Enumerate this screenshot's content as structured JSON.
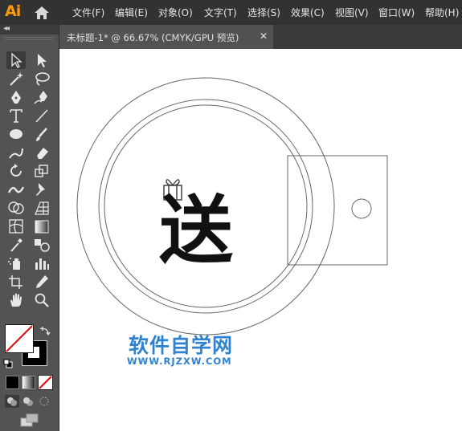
{
  "app": {
    "logo_text": "Ai"
  },
  "menu": {
    "items": [
      "文件(F)",
      "编辑(E)",
      "对象(O)",
      "文字(T)",
      "选择(S)",
      "效果(C)",
      "视图(V)",
      "窗口(W)",
      "帮助(H)"
    ]
  },
  "document_tab": {
    "title": "未标题-1* @ 66.67% (CMYK/GPU 预览)",
    "close_glyph": "✕"
  },
  "toolbox": {
    "collapse_glyph": "◂◂",
    "tools": [
      "selection-tool",
      "direct-selection-tool",
      "magic-wand-tool",
      "lasso-tool",
      "pen-tool",
      "curvature-tool",
      "type-tool",
      "line-segment-tool",
      "ellipse-tool",
      "paintbrush-tool",
      "shaper-tool",
      "eraser-tool",
      "rotate-tool",
      "scale-tool",
      "width-tool",
      "puppet-warp-tool",
      "shape-builder-tool",
      "perspective-grid-tool",
      "mesh-tool",
      "gradient-tool",
      "eyedropper-tool",
      "blend-tool",
      "symbol-sprayer-tool",
      "column-graph-tool",
      "artboard-tool",
      "slice-tool",
      "hand-tool",
      "zoom-tool"
    ],
    "selected_tool": "selection-tool",
    "fill_color": "none",
    "stroke_color": "#000000",
    "color_modes": [
      "color",
      "gradient",
      "none"
    ],
    "draw_modes": [
      "draw-normal",
      "draw-behind",
      "draw-inside"
    ]
  },
  "artwork": {
    "main_glyph": "送",
    "glyph_color": "#111111",
    "outline_color": "#666666"
  },
  "watermark": {
    "cn_text": "软件自学网",
    "url_text": "WWW.RJZXW.COM",
    "color": "#2f82cf"
  }
}
